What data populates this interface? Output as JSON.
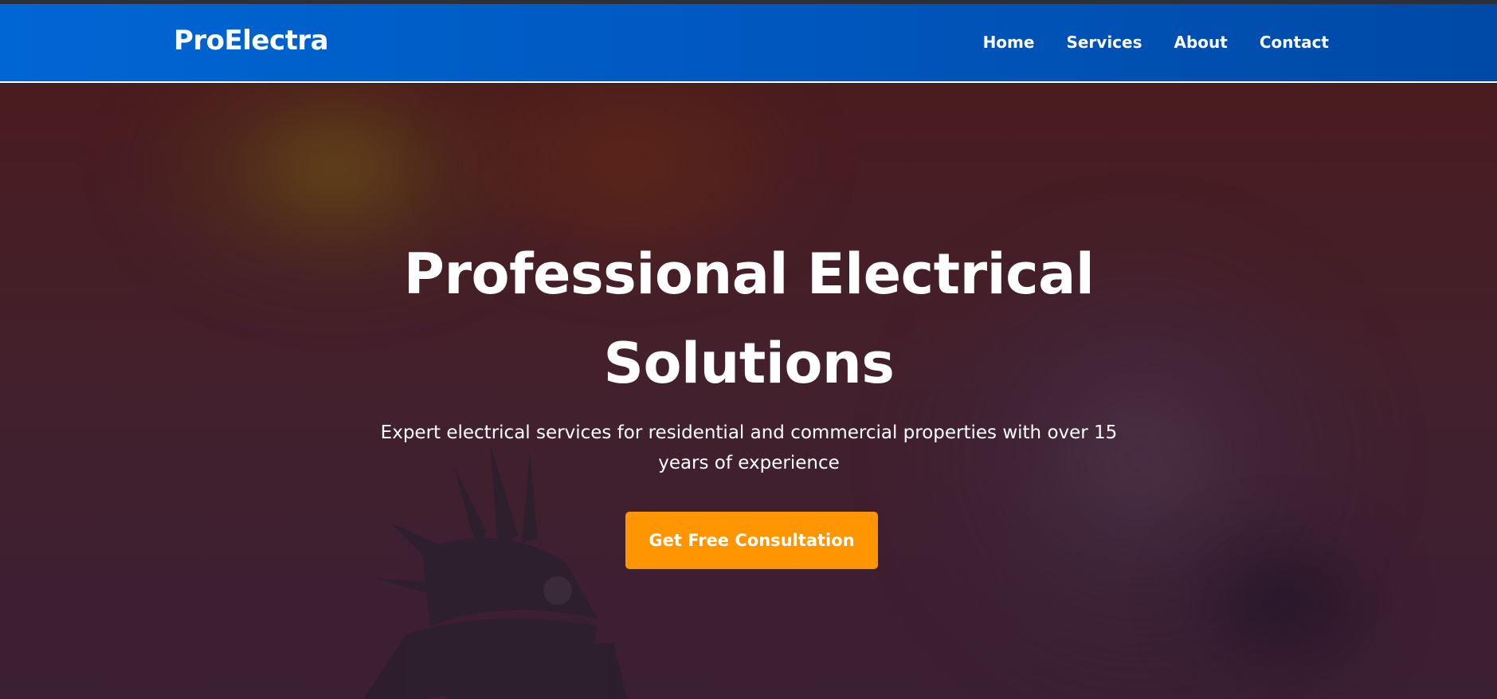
{
  "header": {
    "brand": "ProElectra",
    "nav": [
      "Home",
      "Services",
      "About",
      "Contact"
    ]
  },
  "hero": {
    "title": "Professional Electrical Solutions",
    "subtitle": "Expert electrical services for residential and commercial properties with over 15 years of experience",
    "cta_label": "Get Free Consultation"
  },
  "colors": {
    "header_blue": "#0060cc",
    "cta_orange": "#ff9500",
    "hero_overlay": "#44202a"
  }
}
